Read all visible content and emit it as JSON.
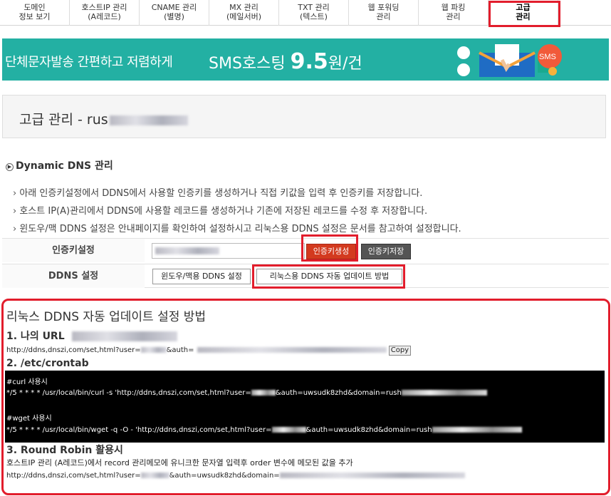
{
  "tabs": [
    {
      "label": "도메인\n정보 보기",
      "active": false
    },
    {
      "label": "호스트IP 관리\n(A레코드)",
      "active": false
    },
    {
      "label": "CNAME 관리\n(별명)",
      "active": false
    },
    {
      "label": "MX 관리\n(메일서버)",
      "active": false
    },
    {
      "label": "TXT 관리\n(텍스트)",
      "active": false
    },
    {
      "label": "웹 포워딩\n관리",
      "active": false
    },
    {
      "label": "웹 파킹\n관리",
      "active": false
    },
    {
      "label": "고급\n관리",
      "active": true
    }
  ],
  "banner": {
    "text_left": "단체문자발송 간편하고 저렴하게",
    "text_service": "SMS호스팅",
    "price": "9.5",
    "unit": "원/건",
    "badge": "SMS"
  },
  "page": {
    "title": "고급 관리 - rus"
  },
  "section": {
    "title": "Dynamic DNS 관리",
    "descriptions": [
      "아래 인증키설정에서 DDNS에서 사용할 인증키를 생성하거나 직접 키값을 입력 후 인증키를 저장합니다.",
      "호스트 IP(A)관리에서 DDNS에 사용할 레코드를 생성하거나 기존에 저장된 레코드를 수정 후 저장합니다.",
      "윈도우/맥 DDNS 설정은 안내페이지를 확인하여 설정하시고 리눅스용 DDNS 설정은 문서를 참고하여 설정합니다."
    ]
  },
  "auth_key": {
    "label": "인증키설정",
    "generate_button": "인증키생성",
    "save_button": "인증키저장"
  },
  "ddns": {
    "label": "DDNS 설정",
    "windows_button": "윈도우/맥용 DDNS 설정",
    "linux_button": "리눅스용 DDNS 자동 업데이트 방법"
  },
  "guide": {
    "title": "리눅스 DDNS 자동 업데이트 설정 방법",
    "step1": {
      "heading": "1. 나의 URL",
      "url_prefix": "http://ddns,dnszi,com/set,html?user=",
      "url_mid": "&auth=",
      "copy_button": "Copy"
    },
    "step2": {
      "heading": "2. /etc/crontab",
      "curl_comment": "#curl 사용시",
      "curl_line_a": "*/5 * * * * /usr/local/bin/curl -s 'http://ddns,dnszi,com/set,html?user=",
      "curl_line_b": "&auth=uwsudk8zhd&domain=rush",
      "wget_comment": "#wget 사용시",
      "wget_line_a": "*/5 * * * * /usr/local/bin/wget -q -O - 'http://ddns,dnszi,com/set,html?user=",
      "wget_line_b": "&auth=uwsudk8zhd&domain=rush"
    },
    "step3": {
      "heading": "3. Round Robin 활용시",
      "text": "호스트IP 관리 (A레코드)에서 record 관리메모에 유니크한 문자열 입력후 order 변수에 메모된 값을 추가",
      "url_a": "http://ddns,dnszi,com/set,html?user=",
      "url_b": "&auth=uwsudk8zhd&domain="
    }
  },
  "colors": {
    "highlight": "#e21d2c",
    "banner": "#23b0a3",
    "generate": "#d33a1f"
  }
}
